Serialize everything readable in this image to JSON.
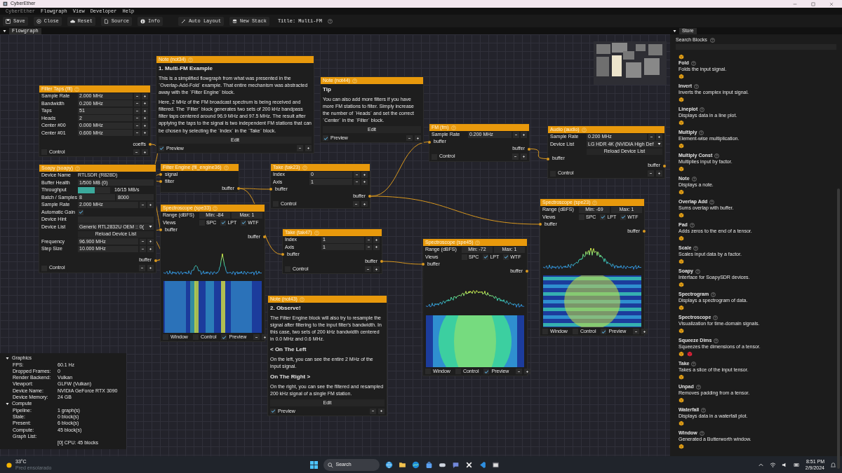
{
  "window": {
    "title": "CyberEther"
  },
  "menu": [
    {
      "label": "CyberEther",
      "disabled": true
    },
    {
      "label": "Flowgraph",
      "disabled": false
    },
    {
      "label": "View",
      "disabled": false
    },
    {
      "label": "Developer",
      "disabled": false
    },
    {
      "label": "Help",
      "disabled": false
    }
  ],
  "toolbar": [
    {
      "label": "Save"
    },
    {
      "label": "Close"
    },
    {
      "label": "Reset"
    },
    {
      "label": "Source"
    },
    {
      "label": "Info"
    },
    {
      "label": "Auto Layout"
    },
    {
      "label": "New Stack"
    }
  ],
  "title_label": "Title: Multi-FM",
  "tabs": {
    "flowgraph": "Flowgraph",
    "store": "Store"
  },
  "nodes": [
    {
      "kind": "block",
      "title": "Filter Taps (flt)",
      "rows": [
        {
          "kind": "number",
          "label": "Sample Rate",
          "value": "2.000 MHz"
        },
        {
          "kind": "number",
          "label": "Bandwidth",
          "value": "0.200 MHz"
        },
        {
          "kind": "number",
          "label": "Taps",
          "value": "51"
        },
        {
          "kind": "number",
          "label": "Heads",
          "value": "2"
        },
        {
          "kind": "number",
          "label": "Center #00",
          "value": "0.000 MHz"
        },
        {
          "kind": "number",
          "label": "Center #01",
          "value": "0.600 MHz"
        }
      ],
      "outputs": [
        "coeffs"
      ],
      "footer": [
        {
          "label": "Control",
          "checked": false
        }
      ]
    },
    {
      "kind": "note",
      "title": "Note (not34)",
      "body": [
        {
          "kind": "heading",
          "text": "1. Multi-FM Example"
        },
        {
          "kind": "para",
          "text": "This is a simplified flowgraph from what was presented in the `Overlap-Add-Fold` example. That entire mechanism was abstracted away with the `Filter Engine` block."
        },
        {
          "kind": "para",
          "text": "Here, 2 MHz of the FM broadcast spectrum is being received and filtered. The `Filter` block generates two sets of 200 kHz bandpass filter taps centered around 96.9 MHz and 97.5 MHz. The result after applying the taps to the signal is two independent FM stations that can be chosen by selecting the `Index` in the `Take` block."
        }
      ],
      "edit": "Edit",
      "footer": [
        {
          "label": "Preview",
          "checked": true
        }
      ]
    },
    {
      "kind": "note",
      "title": "Note (not44)",
      "body": [
        {
          "kind": "heading",
          "text": "Tip"
        },
        {
          "kind": "para",
          "text": "You can also add more filters if you have more FM stations to filter. Simply increase the number of `Heads` and set the correct `Center` in the `Filter` block."
        }
      ],
      "edit": "Edit",
      "footer": [
        {
          "label": "Preview",
          "checked": true
        }
      ]
    },
    {
      "kind": "block",
      "title": "FM (fm)",
      "rows": [
        {
          "kind": "number",
          "label": "Sample Rate",
          "value": "0.200 MHz"
        }
      ],
      "inputs": [
        "buffer"
      ],
      "outputs": [
        "buffer"
      ],
      "footer": [
        {
          "label": "Control",
          "checked": false
        }
      ]
    },
    {
      "kind": "block",
      "title": "Audio (audio)",
      "rows": [
        {
          "kind": "number",
          "label": "Sample Rate",
          "value": "0.200 MHz"
        },
        {
          "kind": "select",
          "label": "Device List",
          "value": "LG HDR 4K (NVIDIA High Def"
        },
        {
          "kind": "button",
          "label": "Reload Device List"
        }
      ],
      "inputs": [
        "buffer"
      ],
      "outputs": [
        "buffer"
      ],
      "footer": [
        {
          "label": "Control",
          "checked": false
        }
      ]
    },
    {
      "kind": "block",
      "title": "Soapy (soapy)",
      "rows": [
        {
          "kind": "info",
          "label": "Device Name",
          "value": "RTLSDR (R828D)"
        },
        {
          "kind": "text",
          "label": "Buffer Health",
          "value": "1/500 MB (0)"
        },
        {
          "kind": "progress",
          "label": "Throughput",
          "level": 0.52,
          "reading": "16/15 MB/s"
        },
        {
          "kind": "pair",
          "label": "Batch / Samples",
          "values": [
            "8",
            "8000"
          ]
        },
        {
          "kind": "number",
          "label": "Sample Rate",
          "value": "2.000 MHz"
        },
        {
          "kind": "check",
          "label": "Automatic Gain",
          "checked": true
        },
        {
          "kind": "text",
          "label": "Device Hint"
        },
        {
          "kind": "select",
          "label": "Device List",
          "value": "Generic RTL2832U OEM :: 0("
        },
        {
          "kind": "button",
          "label": "Reload Device List"
        },
        {
          "kind": "number",
          "label": "Frequency",
          "value": "96.900 MHz"
        },
        {
          "kind": "number",
          "label": "Step Size",
          "value": "10.000 MHz"
        }
      ],
      "outputs": [
        "buffer"
      ],
      "footer": [
        {
          "label": "Control",
          "checked": false
        }
      ]
    },
    {
      "kind": "block",
      "title": "Filter Engine (fil_engine36)",
      "inputs": [
        "signal",
        "filter"
      ],
      "outputs": [
        "buffer"
      ]
    },
    {
      "kind": "block",
      "title": "Take (tak23)",
      "rows": [
        {
          "kind": "number",
          "label": "Index",
          "value": "0"
        },
        {
          "kind": "number",
          "label": "Axis",
          "value": "1"
        }
      ],
      "inputs": [
        "buffer"
      ],
      "outputs": [
        "buffer"
      ],
      "footer": [
        {
          "label": "Control",
          "checked": false
        }
      ]
    },
    {
      "kind": "scope",
      "title": "Spectroscope (spe33)",
      "rows": [
        {
          "kind": "range",
          "label": "Range (dBFS)",
          "values": [
            "Min: -84",
            "Max: 1"
          ]
        },
        {
          "kind": "views",
          "label": "Views",
          "options": [
            {
              "label": "SPC",
              "checked": false
            },
            {
              "label": "LPT",
              "checked": true
            },
            {
              "label": "WTF",
              "checked": true
            }
          ]
        }
      ],
      "inputs": [
        "buffer"
      ],
      "outputs": [
        "buffer"
      ],
      "footer": [
        {
          "label": "Window",
          "checked": false
        },
        {
          "label": "Control",
          "checked": false
        },
        {
          "label": "Preview",
          "checked": true
        }
      ]
    },
    {
      "kind": "scope",
      "title": "Spectroscope (spe23)",
      "rows": [
        {
          "kind": "range",
          "label": "Range (dBFS)",
          "values": [
            "Min: -69",
            "Max: 1"
          ]
        },
        {
          "kind": "views",
          "label": "Views",
          "options": [
            {
              "label": "SPC",
              "checked": false
            },
            {
              "label": "LPT",
              "checked": true
            },
            {
              "label": "WTF",
              "checked": true
            }
          ]
        }
      ],
      "inputs": [
        "buffer"
      ],
      "outputs": [
        "buffer"
      ],
      "footer": [
        {
          "label": "Window",
          "checked": false
        },
        {
          "label": "Control",
          "checked": false
        },
        {
          "label": "Preview",
          "checked": true
        }
      ]
    },
    {
      "kind": "block",
      "title": "Take (tak47)",
      "rows": [
        {
          "kind": "number",
          "label": "Index",
          "value": "1"
        },
        {
          "kind": "number",
          "label": "Axis",
          "value": "1"
        }
      ],
      "inputs": [
        "buffer"
      ],
      "outputs": [
        "buffer"
      ],
      "footer": [
        {
          "label": "Control",
          "checked": false
        }
      ]
    },
    {
      "kind": "scope",
      "title": "Spectroscope (spe45)",
      "rows": [
        {
          "kind": "range",
          "label": "Range (dBFS)",
          "values": [
            "Min: -72",
            "Max: 1"
          ]
        },
        {
          "kind": "views",
          "label": "Views",
          "options": [
            {
              "label": "SPC",
              "checked": false
            },
            {
              "label": "LPT",
              "checked": true
            },
            {
              "label": "WTF",
              "checked": true
            }
          ]
        }
      ],
      "inputs": [
        "buffer"
      ],
      "outputs": [
        "buffer"
      ],
      "footer": [
        {
          "label": "Window",
          "checked": false
        },
        {
          "label": "Control",
          "checked": false
        },
        {
          "label": "Preview",
          "checked": true
        }
      ]
    },
    {
      "kind": "note",
      "title": "Note (not43)",
      "body": [
        {
          "kind": "heading",
          "text": "2. Observe!"
        },
        {
          "kind": "para",
          "text": "The Filter Engine block will also try to resample the signal after filtering to the input filter's bandwidth. In this case, two sets of 200 kHz bandwidth centered in 0.0 MHz and 0.6 MHz."
        },
        {
          "kind": "heading",
          "text": "< On The Left"
        },
        {
          "kind": "para",
          "text": "On the left, you can see the entire 2 MHz of the input signal."
        },
        {
          "kind": "heading",
          "text": "On The Right >"
        },
        {
          "kind": "para",
          "text": "On the right, you can see the filtered and resampled 200 kHz signal of a single FM station."
        }
      ],
      "edit": "Edit",
      "footer": [
        {
          "label": "Preview",
          "checked": true
        }
      ]
    }
  ],
  "stats": [
    {
      "title": "Graphics",
      "expanded": true,
      "rows": [
        {
          "label": "FPS:",
          "value": "60.1 Hz"
        },
        {
          "label": "Dropped Frames:",
          "value": "0"
        },
        {
          "label": "Render Backend:",
          "value": "Vulkan"
        },
        {
          "label": "Viewport:",
          "value": "GLFW (Vulkan)"
        },
        {
          "label": "Device Name:",
          "value": "NVIDIA GeForce RTX 3090"
        },
        {
          "label": "Device Memory:",
          "value": "24 GB"
        }
      ]
    },
    {
      "title": "Compute",
      "expanded": true,
      "rows": [
        {
          "label": "Pipeline:",
          "value": "1 graph(s)"
        },
        {
          "label": "Stale:",
          "value": "0 block(s)"
        },
        {
          "label": "Present:",
          "value": "6 block(s)"
        },
        {
          "label": "Compute:",
          "value": "45 block(s)"
        },
        {
          "label": "Graph List:"
        },
        {
          "value": "[0] CPU: 45 blocks"
        }
      ]
    }
  ],
  "store": {
    "search_label": "Search Blocks",
    "items": [
      {
        "badges": [
          {
            "color": "#e8a317"
          }
        ]
      },
      {
        "name": "Fold",
        "description": "Folds the input signal.",
        "badges": [
          {
            "color": "#e8a317"
          }
        ]
      },
      {
        "name": "Invert",
        "description": "Inverts the complex input signal.",
        "badges": [
          {
            "color": "#e8a317"
          }
        ]
      },
      {
        "name": "Lineplot",
        "description": "Displays data in a line plot.",
        "badges": [
          {
            "color": "#e8a317"
          }
        ]
      },
      {
        "name": "Multiply",
        "description": "Element-wise multiplication.",
        "badges": [
          {
            "color": "#e8a317"
          }
        ]
      },
      {
        "name": "Multiply Const",
        "description": "Multiplies input by factor.",
        "badges": [
          {
            "color": "#e8a317"
          }
        ]
      },
      {
        "name": "Note",
        "description": "Displays a note.",
        "badges": [
          {
            "color": "#e8a317"
          }
        ]
      },
      {
        "name": "Overlap Add",
        "description": "Sums overlap with buffer.",
        "badges": [
          {
            "color": "#e8a317"
          }
        ]
      },
      {
        "name": "Pad",
        "description": "Adds zeros to the end of a tensor.",
        "badges": [
          {
            "color": "#e8a317"
          }
        ]
      },
      {
        "name": "Scale",
        "description": "Scales input data by a factor.",
        "badges": [
          {
            "color": "#e8a317"
          }
        ]
      },
      {
        "name": "Soapy",
        "description": "Interface for SoapySDR devices.",
        "badges": [
          {
            "color": "#e8a317"
          }
        ]
      },
      {
        "name": "Spectrogram",
        "description": "Displays a spectrogram of data.",
        "badges": [
          {
            "color": "#e8a317"
          }
        ]
      },
      {
        "name": "Spectroscope",
        "description": "Visualization for time-domain signals.",
        "badges": [
          {
            "color": "#e8a317"
          }
        ]
      },
      {
        "name": "Squeeze Dims",
        "description": "Squeezes the dimensions of a tensor.",
        "badges": [
          {
            "color": "#e8a317"
          },
          {
            "color": "#e0243a"
          }
        ]
      },
      {
        "name": "Take",
        "description": "Takes a slice of the input tensor.",
        "badges": [
          {
            "color": "#e8a317"
          }
        ]
      },
      {
        "name": "Unpad",
        "description": "Removes padding from a tensor.",
        "badges": [
          {
            "color": "#e8a317"
          }
        ]
      },
      {
        "name": "Waterfall",
        "description": "Displays data in a waterfall plot.",
        "badges": [
          {
            "color": "#e8a317"
          }
        ]
      },
      {
        "name": "Window",
        "description": "Generated a Butterworth window.",
        "badges": [
          {
            "color": "#e8a317"
          }
        ]
      }
    ]
  },
  "taskbar": {
    "temperature": "33°C",
    "forecast": "Pred ensolarado",
    "search": "Search",
    "time": "8:51 PM",
    "date": "2/9/2024"
  }
}
